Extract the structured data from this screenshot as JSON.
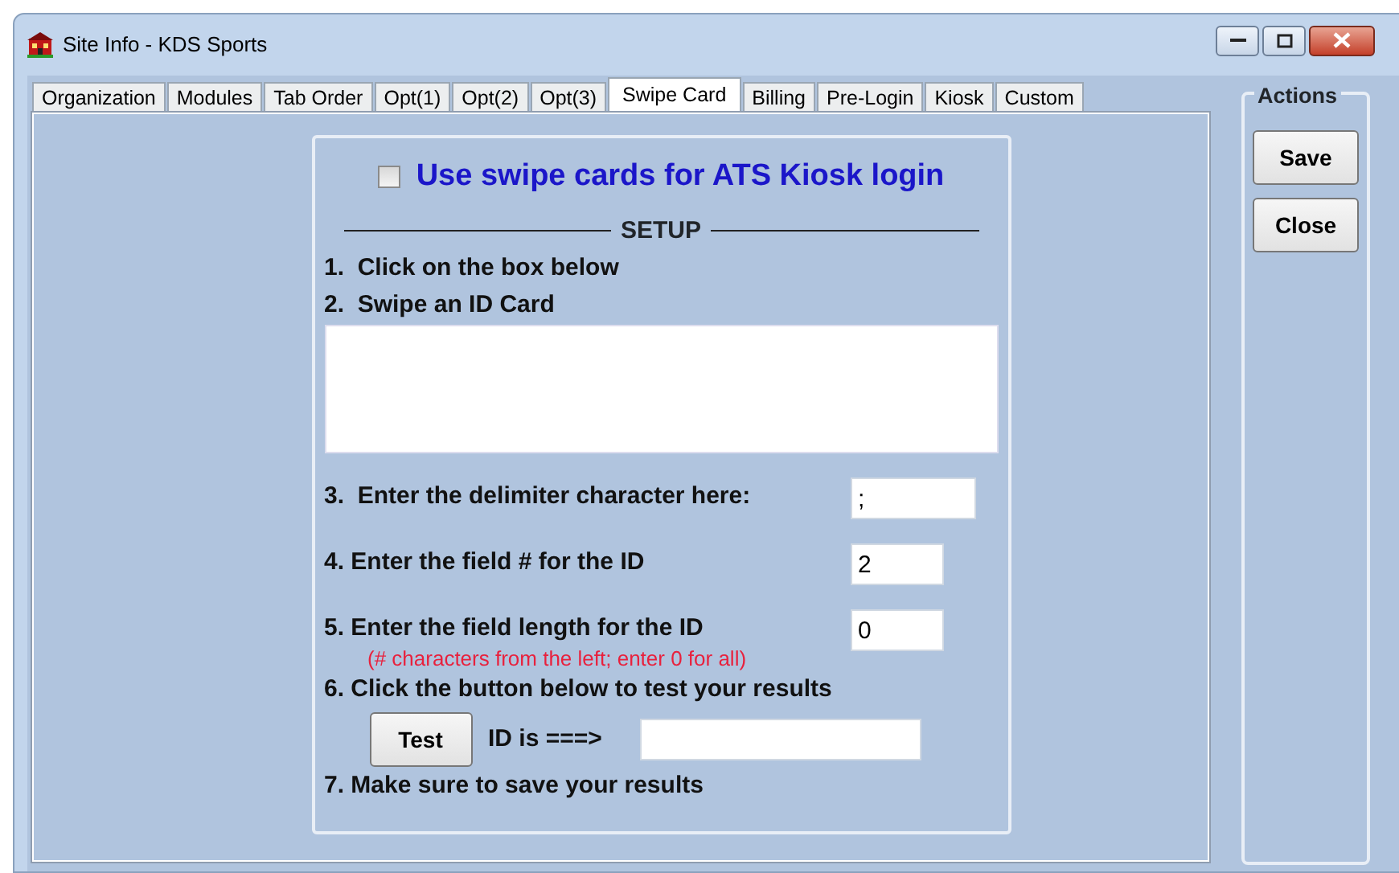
{
  "window": {
    "title": "Site Info - KDS Sports"
  },
  "tabs": [
    {
      "label": "Organization",
      "selected": false
    },
    {
      "label": "Modules",
      "selected": false
    },
    {
      "label": "Tab Order",
      "selected": false
    },
    {
      "label": "Opt(1)",
      "selected": false
    },
    {
      "label": "Opt(2)",
      "selected": false
    },
    {
      "label": "Opt(3)",
      "selected": false
    },
    {
      "label": "Swipe Card",
      "selected": true
    },
    {
      "label": "Billing",
      "selected": false
    },
    {
      "label": "Pre-Login",
      "selected": false
    },
    {
      "label": "Kiosk",
      "selected": false
    },
    {
      "label": "Custom",
      "selected": false
    }
  ],
  "swipe": {
    "enable": {
      "label": "Use swipe cards for ATS Kiosk login",
      "checked": false
    },
    "setup_heading": "SETUP",
    "steps": [
      {
        "kind": "text",
        "label": "1.  Click on the box below"
      },
      {
        "kind": "text",
        "label": "2.  Swipe an ID Card"
      },
      {
        "kind": "area"
      },
      {
        "kind": "field",
        "label": "3.  Enter the delimiter character here:",
        "value": ";",
        "wide": true
      },
      {
        "kind": "field",
        "label": "4. Enter the field # for the ID",
        "value": "2",
        "wide": false
      },
      {
        "kind": "field",
        "label": "5. Enter the field length for the ID",
        "note": "(# characters from the left; enter 0 for all)",
        "value": "0",
        "wide": false
      },
      {
        "kind": "text",
        "label": "6. Click the button below to test your results"
      },
      {
        "kind": "test",
        "button": "Test",
        "label": "ID is ===>"
      },
      {
        "kind": "text",
        "label": "7. Make sure to save your results"
      }
    ]
  },
  "actions": {
    "title": "Actions",
    "buttons": [
      "Save",
      "Close"
    ]
  }
}
